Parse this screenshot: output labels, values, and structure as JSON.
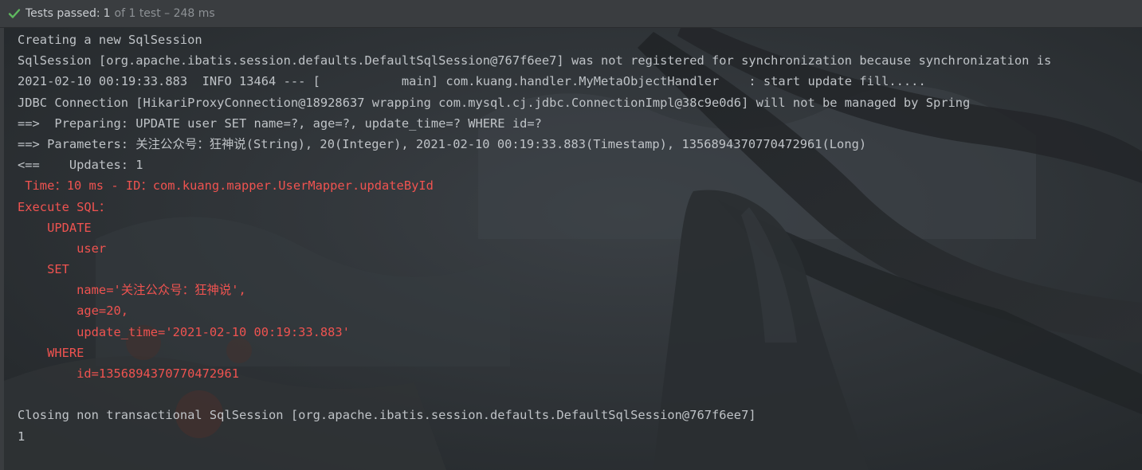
{
  "status": {
    "passed_label": "Tests passed:",
    "count": "1",
    "rest": "of 1 test – 248 ms",
    "icon": "checkmark-icon",
    "color_passed": "#5fb85f"
  },
  "console": {
    "lines": [
      {
        "text": "Creating a new SqlSession",
        "kind": "normal"
      },
      {
        "text": "SqlSession [org.apache.ibatis.session.defaults.DefaultSqlSession@767f6ee7] was not registered for synchronization because synchronization is",
        "kind": "normal"
      },
      {
        "text": "2021-02-10 00:19:33.883  INFO 13464 --- [           main] com.kuang.handler.MyMetaObjectHandler    : start update fill.....",
        "kind": "normal"
      },
      {
        "text": "JDBC Connection [HikariProxyConnection@18928637 wrapping com.mysql.cj.jdbc.ConnectionImpl@38c9e0d6] will not be managed by Spring",
        "kind": "normal"
      },
      {
        "text": "==>  Preparing: UPDATE user SET name=?, age=?, update_time=? WHERE id=?",
        "kind": "normal"
      },
      {
        "text": "==> Parameters: 关注公众号：狂神说(String), 20(Integer), 2021-02-10 00:19:33.883(Timestamp), 1356894370770472961(Long)",
        "kind": "normal"
      },
      {
        "text": "<==    Updates: 1",
        "kind": "normal"
      },
      {
        "text": " Time：10 ms - ID：com.kuang.mapper.UserMapper.updateById",
        "kind": "err"
      },
      {
        "text": "Execute SQL：",
        "kind": "err"
      },
      {
        "text": "    UPDATE",
        "kind": "err"
      },
      {
        "text": "        user",
        "kind": "err"
      },
      {
        "text": "    SET",
        "kind": "err"
      },
      {
        "text": "        name='关注公众号：狂神说',",
        "kind": "err"
      },
      {
        "text": "        age=20,",
        "kind": "err"
      },
      {
        "text": "        update_time='2021-02-10 00:19:33.883'",
        "kind": "err"
      },
      {
        "text": "    WHERE",
        "kind": "err"
      },
      {
        "text": "        id=1356894370770472961",
        "kind": "err"
      },
      {
        "text": "",
        "kind": "normal"
      },
      {
        "text": "Closing non transactional SqlSession [org.apache.ibatis.session.defaults.DefaultSqlSession@767f6ee7]",
        "kind": "normal"
      },
      {
        "text": "1",
        "kind": "normal"
      }
    ]
  }
}
